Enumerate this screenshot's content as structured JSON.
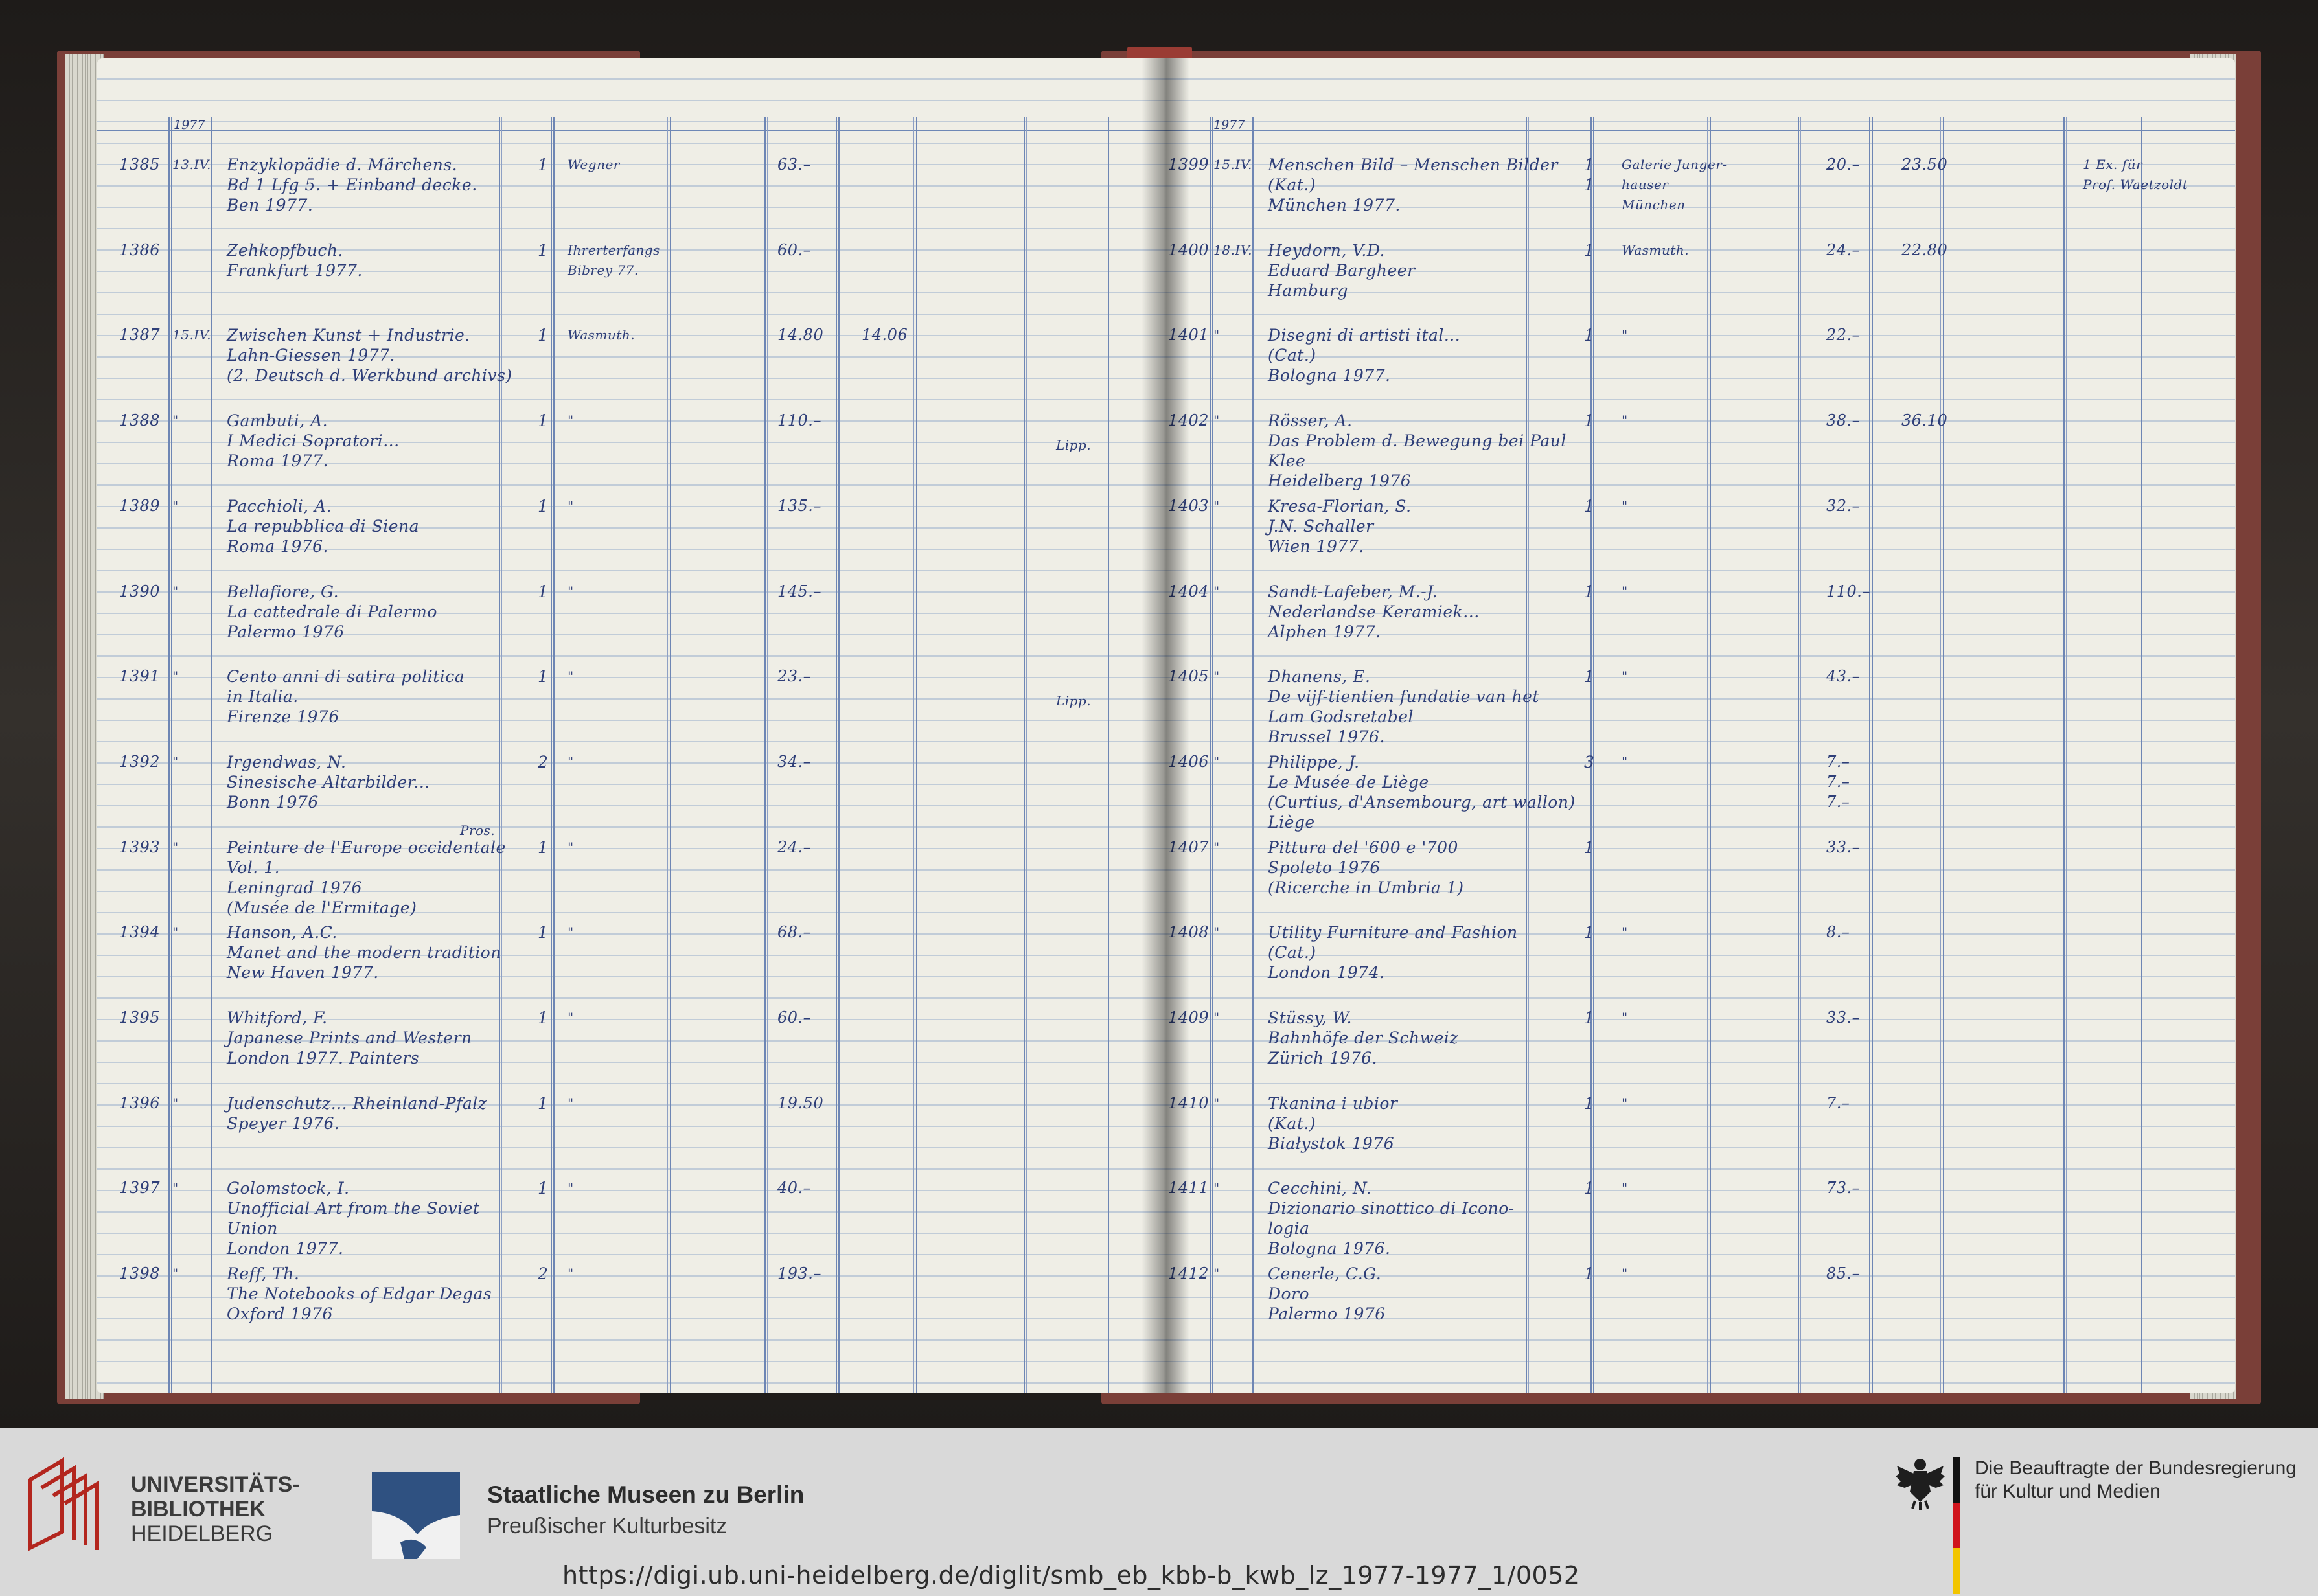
{
  "ledger": {
    "left_page": {
      "year_header": "1977",
      "entries": [
        {
          "nr": "1385",
          "date": "13.IV.",
          "title": [
            "Enzyklopädie d. Märchens.",
            "Bd 1 Lfg 5. + Einband decke.",
            "Ben 1977."
          ],
          "qty": "1",
          "dealer": "Wegner",
          "price": "63.–",
          "paid": "",
          "note": ""
        },
        {
          "nr": "1386",
          "date": "",
          "title": [
            "Zehkopfbuch.",
            "Frankfurt 1977."
          ],
          "qty": "1",
          "dealer": "Ihrerterfangs",
          "dealer2": "Bibrey 77.",
          "price": "60.–",
          "paid": "",
          "note": ""
        },
        {
          "nr": "1387",
          "date": "15.IV.",
          "title": [
            "Zwischen Kunst + Industrie.",
            "Lahn-Giessen 1977.",
            "(2. Deutsch d. Werkbund archivs)"
          ],
          "qty": "1",
          "dealer": "Wasmuth.",
          "price": "14.80",
          "paid": "14.06",
          "note": ""
        },
        {
          "nr": "1388",
          "date": "\"",
          "title": [
            "Gambuti, A.",
            "I Medici Sopratori...",
            "Roma 1977."
          ],
          "qty": "1",
          "dealer": "\"",
          "price": "110.–",
          "paid": "",
          "note": "Lipp."
        },
        {
          "nr": "1389",
          "date": "\"",
          "title": [
            "Pacchioli, A.",
            "La repubblica di Siena",
            "Roma 1976."
          ],
          "qty": "1",
          "dealer": "\"",
          "price": "135.–",
          "paid": "",
          "note": ""
        },
        {
          "nr": "1390",
          "date": "\"",
          "title": [
            "Bellafiore, G.",
            "La cattedrale di Palermo",
            "Palermo 1976"
          ],
          "qty": "1",
          "dealer": "\"",
          "price": "145.–",
          "paid": "",
          "note": ""
        },
        {
          "nr": "1391",
          "date": "\"",
          "title": [
            "Cento anni di satira politica",
            "in Italia.",
            "Firenze 1976"
          ],
          "qty": "1",
          "dealer": "\"",
          "price": "23.–",
          "paid": "",
          "note": "Lipp."
        },
        {
          "nr": "1392",
          "date": "\"",
          "title": [
            "Irgendwas, N.",
            "Sinesische Altarbilder...",
            "Bonn 1976"
          ],
          "qty": "2",
          "dealer": "\"",
          "price": "34.–",
          "paid": "",
          "note": ""
        },
        {
          "nr": "1393",
          "date": "\"",
          "title": [
            "Peinture de l'Europe occidentale",
            "Vol. 1.",
            "Leningrad 1976",
            "(Musée de l'Ermitage)"
          ],
          "qty": "1",
          "dealer": "\"",
          "price": "24.–",
          "paid": "",
          "note": "",
          "extra": "Pros."
        },
        {
          "nr": "1394",
          "date": "\"",
          "title": [
            "Hanson, A.C.",
            "Manet and the modern tradition",
            "New Haven 1977."
          ],
          "qty": "1",
          "dealer": "\"",
          "price": "68.–",
          "paid": "",
          "note": ""
        },
        {
          "nr": "1395",
          "date": "",
          "title": [
            "Whitford, F.",
            "Japanese Prints and Western",
            "London 1977.   Painters"
          ],
          "qty": "1",
          "dealer": "\"",
          "price": "60.–",
          "paid": "",
          "note": ""
        },
        {
          "nr": "1396",
          "date": "\"",
          "title": [
            "Judenschutz... Rheinland-Pfalz",
            "Speyer 1976."
          ],
          "qty": "1",
          "dealer": "\"",
          "price": "19.50",
          "paid": "",
          "note": ""
        },
        {
          "nr": "1397",
          "date": "\"",
          "title": [
            "Golomstock, I.",
            "Unofficial Art from the Soviet",
            "Union",
            "London 1977."
          ],
          "qty": "1",
          "dealer": "\"",
          "price": "40.–",
          "paid": "",
          "note": ""
        },
        {
          "nr": "1398",
          "date": "\"",
          "title": [
            "Reff, Th.",
            "The Notebooks of Edgar Degas",
            "Oxford 1976"
          ],
          "qty": "2",
          "dealer": "\"",
          "price": "193.–",
          "paid": "",
          "note": ""
        }
      ]
    },
    "right_page": {
      "year_header": "1977",
      "entries": [
        {
          "nr": "1399",
          "date": "15.IV.",
          "title": [
            "Menschen Bild – Menschen Bilder",
            "(Kat.)",
            "München 1977."
          ],
          "qty": "1",
          "qty2": "1",
          "dealer": "Galerie Junger-",
          "dealer2": "hauser",
          "dealer3": "München",
          "price": "20.–",
          "paid": "23.50",
          "note": "1 Ex. für",
          "note2": "Prof. Waetzoldt"
        },
        {
          "nr": "1400",
          "date": "18.IV.",
          "title": [
            "Heydorn, V.D.",
            "Eduard Bargheer",
            "Hamburg"
          ],
          "qty": "1",
          "dealer": "Wasmuth.",
          "price": "24.–",
          "paid": "22.80",
          "note": ""
        },
        {
          "nr": "1401",
          "date": "\"",
          "title": [
            "Disegni di artisti ital...",
            "(Cat.)",
            "Bologna 1977."
          ],
          "qty": "1",
          "dealer": "\"",
          "price": "22.–",
          "paid": "",
          "note": ""
        },
        {
          "nr": "1402",
          "date": "\"",
          "title": [
            "Rösser, A.",
            "Das Problem d. Bewegung bei Paul",
            "Klee",
            "Heidelberg 1976"
          ],
          "qty": "1",
          "dealer": "\"",
          "price": "38.–",
          "paid": "36.10",
          "note": ""
        },
        {
          "nr": "1403",
          "date": "\"",
          "title": [
            "Kresa-Florian, S.",
            "J.N. Schaller",
            "Wien 1977."
          ],
          "qty": "1",
          "dealer": "\"",
          "price": "32.–",
          "paid": "",
          "note": ""
        },
        {
          "nr": "1404",
          "date": "\"",
          "title": [
            "Sandt-Lafeber, M.-J.",
            "Nederlandse Keramiek...",
            "Alphen 1977."
          ],
          "qty": "1",
          "dealer": "\"",
          "price": "110.–",
          "paid": "",
          "note": ""
        },
        {
          "nr": "1405",
          "date": "\"",
          "title": [
            "Dhanens, E.",
            "De vijf-tientien fundatie van het",
            "Lam Godsretabel",
            "Brussel 1976."
          ],
          "qty": "1",
          "dealer": "\"",
          "price": "43.–",
          "paid": "",
          "note": ""
        },
        {
          "nr": "1406",
          "date": "\"",
          "title": [
            "Philippe, J.",
            "Le Musée de Liège",
            "(Curtius, d'Ansembourg, art wallon)",
            "Liège"
          ],
          "qty": "3",
          "dealer": "\"",
          "price": "7.–",
          "price2": "7.–",
          "price3": "7.–",
          "paid": "",
          "note": ""
        },
        {
          "nr": "1407",
          "date": "\"",
          "title": [
            "Pittura del '600 e '700",
            "Spoleto 1976",
            "(Ricerche in Umbria 1)"
          ],
          "qty": "1",
          "dealer": "",
          "price": "33.–",
          "paid": "",
          "note": ""
        },
        {
          "nr": "1408",
          "date": "\"",
          "title": [
            "Utility Furniture and Fashion",
            "(Cat.)",
            "London 1974."
          ],
          "qty": "1",
          "dealer": "\"",
          "price": "8.–",
          "paid": "",
          "note": ""
        },
        {
          "nr": "1409",
          "date": "\"",
          "title": [
            "Stüssy, W.",
            "Bahnhöfe der Schweiz",
            "Zürich 1976."
          ],
          "qty": "1",
          "dealer": "\"",
          "price": "33.–",
          "paid": "",
          "note": ""
        },
        {
          "nr": "1410",
          "date": "\"",
          "title": [
            "Tkanina i ubior",
            "(Kat.)",
            "Białystok 1976"
          ],
          "qty": "1",
          "dealer": "\"",
          "price": "7.–",
          "paid": "",
          "note": ""
        },
        {
          "nr": "1411",
          "date": "\"",
          "title": [
            "Cecchini, N.",
            "Dizionario sinottico di Icono-",
            "logia",
            "Bologna 1976."
          ],
          "qty": "1",
          "dealer": "\"",
          "price": "73.–",
          "paid": "",
          "note": ""
        },
        {
          "nr": "1412",
          "date": "\"",
          "title": [
            "Cenerle, C.G.",
            "Doro",
            "Palermo 1976"
          ],
          "qty": "1",
          "dealer": "\"",
          "price": "85.–",
          "paid": "",
          "note": ""
        }
      ]
    }
  },
  "footer": {
    "ub_line1": "UNIVERSITÄTS-",
    "ub_line2": "BIBLIOTHEK",
    "ub_line3": "HEIDELBERG",
    "smb_title": "Staatliche Museen zu Berlin",
    "smb_subtitle": "Preußischer Kulturbesitz",
    "bkm_line1": "Die Beauftragte der Bundesregierung",
    "bkm_line2": "für Kultur und Medien",
    "url": "https://digi.ub.uni-heidelberg.de/diglit/smb_eb_kbb-b_kwb_lz_1977-1977_1/0052",
    "colors": {
      "footer_bg": "#d9d9d9",
      "ub_red": "#b3261e",
      "smb_blue": "#2f5181",
      "ink": "#2f3f78"
    }
  }
}
